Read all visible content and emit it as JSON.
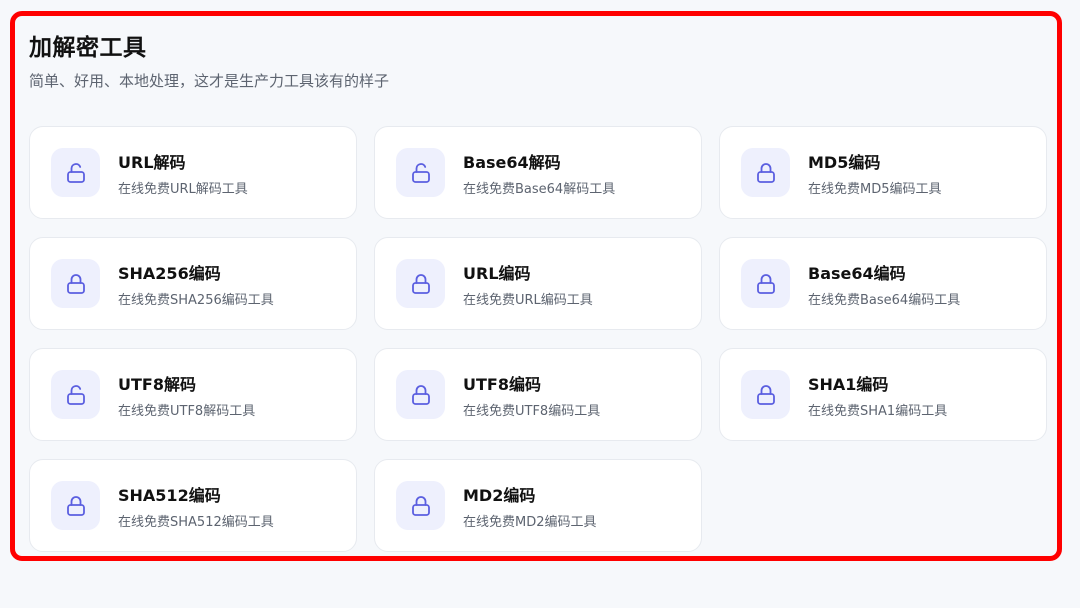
{
  "header": {
    "title": "加解密工具",
    "subtitle": "简单、好用、本地处理，这才是生产力工具该有的样子"
  },
  "colors": {
    "frame_border": "#ff0000",
    "icon_accent": "#5b5fe0",
    "icon_bg": "#eef0fd",
    "background": "#f6f8fb"
  },
  "tools": [
    {
      "name": "URL解码",
      "desc": "在线免费URL解码工具",
      "icon": "unlock-icon"
    },
    {
      "name": "Base64解码",
      "desc": "在线免费Base64解码工具",
      "icon": "unlock-icon"
    },
    {
      "name": "MD5编码",
      "desc": "在线免费MD5编码工具",
      "icon": "lock-icon"
    },
    {
      "name": "SHA256编码",
      "desc": "在线免费SHA256编码工具",
      "icon": "lock-icon"
    },
    {
      "name": "URL编码",
      "desc": "在线免费URL编码工具",
      "icon": "lock-icon"
    },
    {
      "name": "Base64编码",
      "desc": "在线免费Base64编码工具",
      "icon": "lock-icon"
    },
    {
      "name": "UTF8解码",
      "desc": "在线免费UTF8解码工具",
      "icon": "unlock-icon"
    },
    {
      "name": "UTF8编码",
      "desc": "在线免费UTF8编码工具",
      "icon": "lock-icon"
    },
    {
      "name": "SHA1编码",
      "desc": "在线免费SHA1编码工具",
      "icon": "lock-icon"
    },
    {
      "name": "SHA512编码",
      "desc": "在线免费SHA512编码工具",
      "icon": "lock-icon"
    },
    {
      "name": "MD2编码",
      "desc": "在线免费MD2编码工具",
      "icon": "lock-icon"
    }
  ]
}
